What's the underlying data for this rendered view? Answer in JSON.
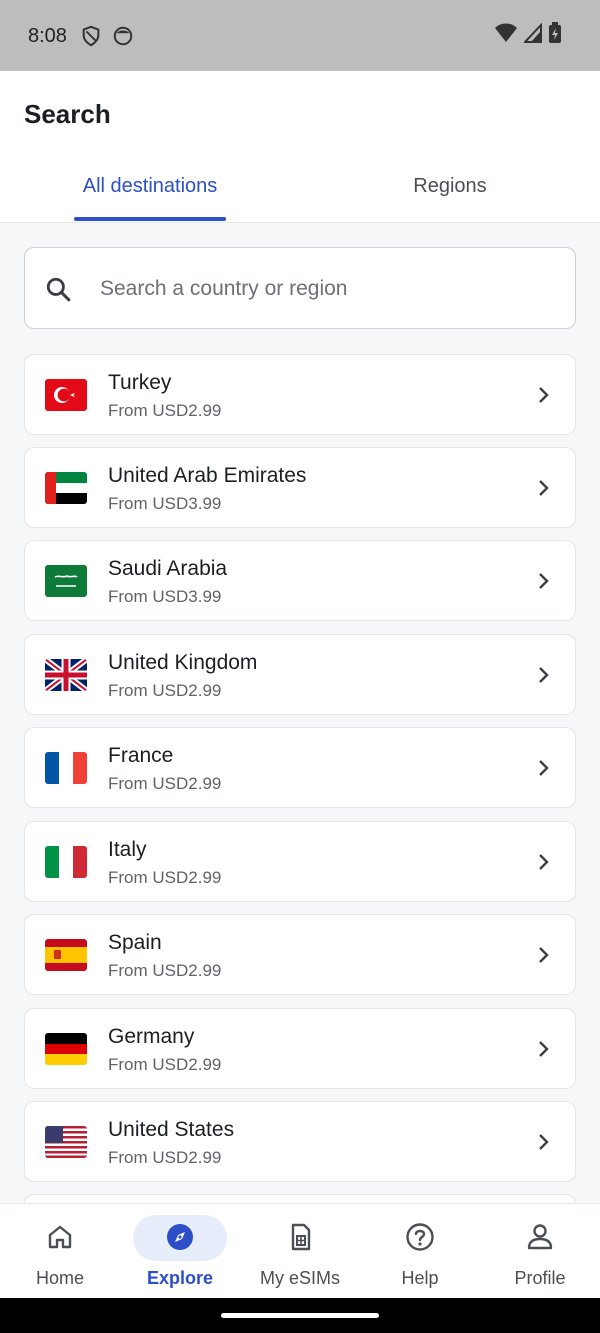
{
  "status_bar": {
    "time": "8:08"
  },
  "header": {
    "title": "Search",
    "tabs": [
      {
        "label": "All destinations",
        "active": true
      },
      {
        "label": "Regions",
        "active": false
      }
    ]
  },
  "search": {
    "placeholder": "Search a country or region"
  },
  "destinations": [
    {
      "name": "Turkey",
      "price": "From USD2.99",
      "flag": "turkey-flag-icon"
    },
    {
      "name": "United Arab Emirates",
      "price": "From USD3.99",
      "flag": "uae-flag-icon"
    },
    {
      "name": "Saudi Arabia",
      "price": "From USD3.99",
      "flag": "saudi-arabia-flag-icon"
    },
    {
      "name": "United Kingdom",
      "price": "From USD2.99",
      "flag": "uk-flag-icon"
    },
    {
      "name": "France",
      "price": "From USD2.99",
      "flag": "france-flag-icon"
    },
    {
      "name": "Italy",
      "price": "From USD2.99",
      "flag": "italy-flag-icon"
    },
    {
      "name": "Spain",
      "price": "From USD2.99",
      "flag": "spain-flag-icon"
    },
    {
      "name": "Germany",
      "price": "From USD2.99",
      "flag": "germany-flag-icon"
    },
    {
      "name": "United States",
      "price": "From USD2.99",
      "flag": "usa-flag-icon"
    }
  ],
  "bottom_nav": [
    {
      "label": "Home",
      "icon": "home-icon",
      "active": false
    },
    {
      "label": "Explore",
      "icon": "compass-icon",
      "active": true
    },
    {
      "label": "My eSIMs",
      "icon": "sim-card-icon",
      "active": false
    },
    {
      "label": "Help",
      "icon": "help-icon",
      "active": false
    },
    {
      "label": "Profile",
      "icon": "profile-icon",
      "active": false
    }
  ],
  "colors": {
    "accent": "#2c4fc7",
    "active_pill": "#e7edfb",
    "background": "#f6f7f9"
  }
}
